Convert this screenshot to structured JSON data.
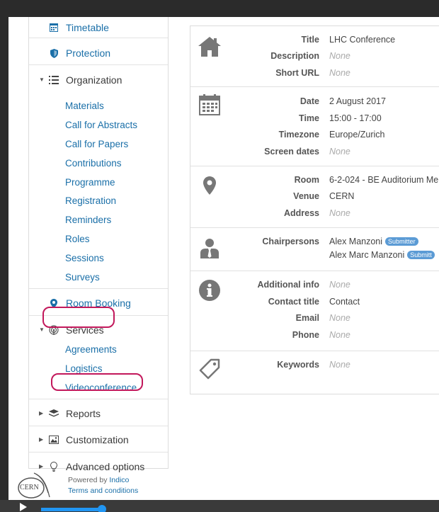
{
  "sidebar": {
    "top_items": [
      {
        "label": "Timetable",
        "icon": "calendar-grid-icon"
      },
      {
        "label": "Protection",
        "icon": "shield-icon"
      }
    ],
    "organization": {
      "label": "Organization",
      "icon": "list-icon",
      "children": [
        "Materials",
        "Call for Abstracts",
        "Call for Papers",
        "Contributions",
        "Programme",
        "Registration",
        "Reminders",
        "Roles",
        "Sessions",
        "Surveys"
      ]
    },
    "room_booking": {
      "label": "Room Booking",
      "icon": "map-pin-icon"
    },
    "services": {
      "label": "Services",
      "icon": "broadcast-icon",
      "children": [
        "Agreements",
        "Logistics",
        "Videoconference"
      ]
    },
    "reports": {
      "label": "Reports",
      "icon": "layers-icon"
    },
    "customization": {
      "label": "Customization",
      "icon": "image-icon"
    },
    "advanced": {
      "label": "Advanced options",
      "icon": "lightbulb-icon"
    }
  },
  "footer": {
    "logo_text": "CERN",
    "powered_prefix": "Powered by ",
    "powered_link": "Indico",
    "terms": "Terms and conditions"
  },
  "details": {
    "general": {
      "icon": "house-icon",
      "title_label": "Title",
      "title_value": "LHC Conference",
      "description_label": "Description",
      "description_value": "None",
      "shorturl_label": "Short URL",
      "shorturl_value": "None"
    },
    "dates": {
      "icon": "calendar-icon",
      "date_label": "Date",
      "date_value": "2 August 2017",
      "time_label": "Time",
      "time_value": "15:00 - 17:00",
      "timezone_label": "Timezone",
      "timezone_value": "Europe/Zurich",
      "screen_label": "Screen dates",
      "screen_value": "None"
    },
    "location": {
      "icon": "map-pin-icon",
      "room_label": "Room",
      "room_value": "6-2-024 - BE Auditorium Me",
      "venue_label": "Venue",
      "venue_value": "CERN",
      "address_label": "Address",
      "address_value": "None"
    },
    "chairs": {
      "icon": "person-tie-icon",
      "label": "Chairpersons",
      "people": [
        {
          "name": "Alex Manzoni",
          "badge": "Submitter"
        },
        {
          "name": "Alex Marc Manzoni",
          "badge": "Submitt"
        }
      ]
    },
    "contact": {
      "icon": "info-icon",
      "additional_label": "Additional info",
      "additional_value": "None",
      "contact_title_label": "Contact title",
      "contact_title_value": "Contact",
      "email_label": "Email",
      "email_value": "None",
      "phone_label": "Phone",
      "phone_value": "None"
    },
    "keywords": {
      "icon": "tag-icon",
      "label": "Keywords",
      "value": "None"
    }
  },
  "video": {
    "progress": 0.2
  }
}
